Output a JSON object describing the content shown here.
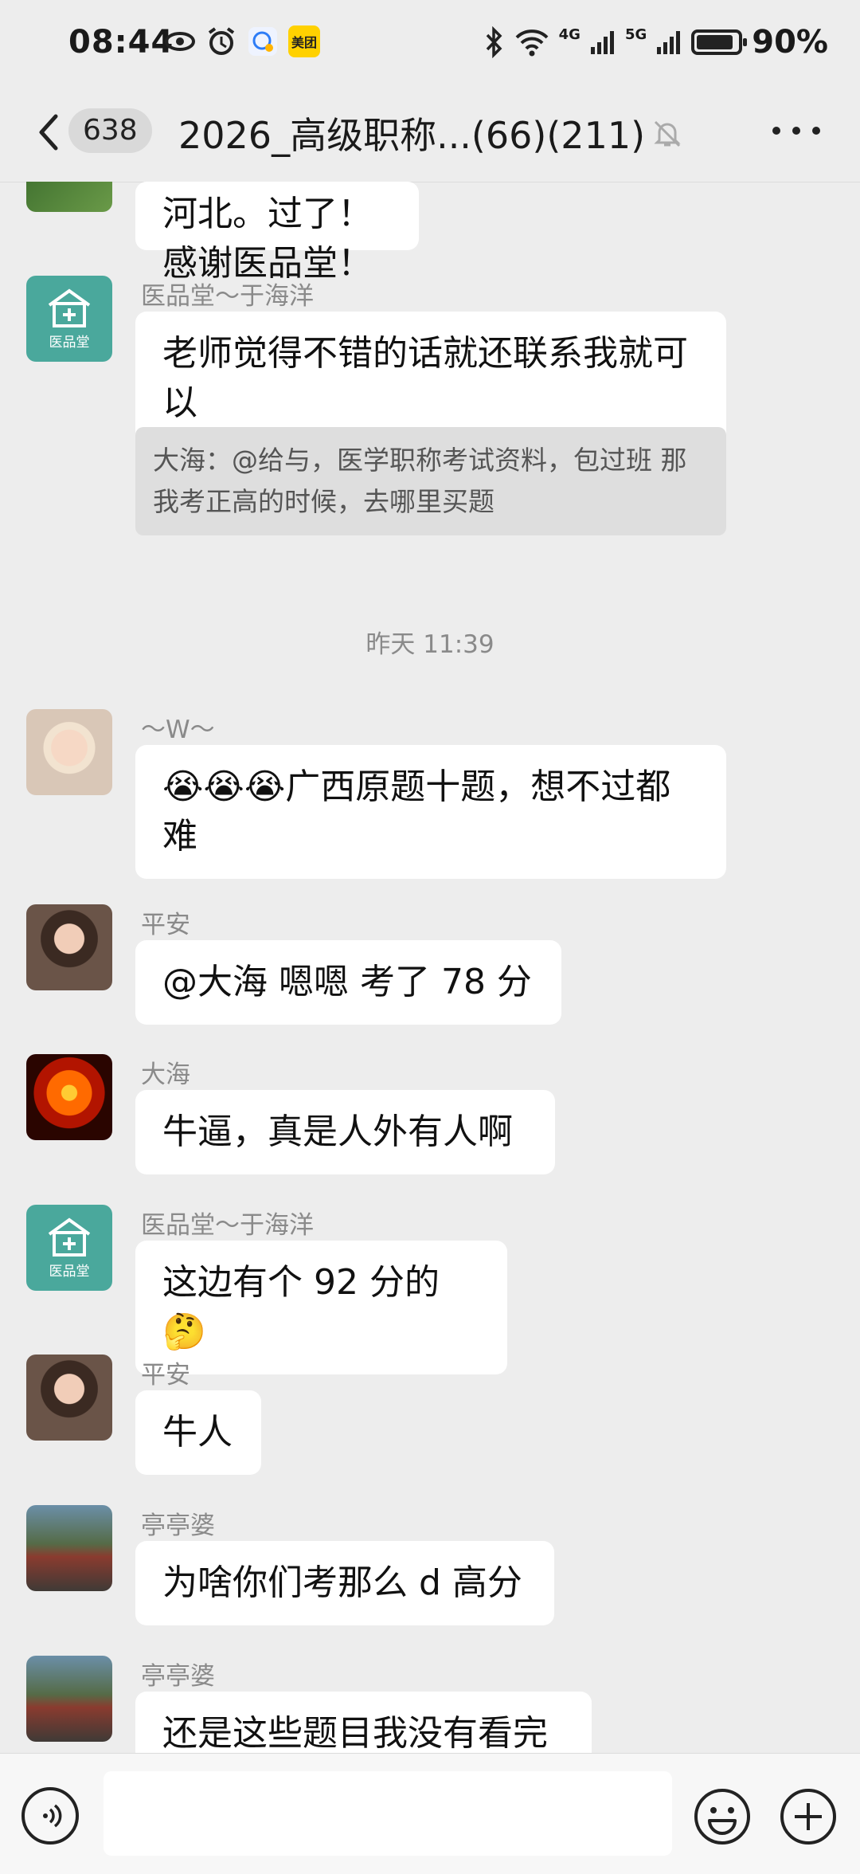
{
  "status": {
    "time": "08:44",
    "meituan": "美团",
    "net4g": "4G",
    "net5g": "5G",
    "battery_percent": "90%",
    "battery_level": 0.9
  },
  "nav": {
    "unread_count": "638",
    "title": "2026_高级职称...(66)(211)"
  },
  "chat": {
    "msg1": {
      "text": "河北。过了！感谢医品堂！"
    },
    "msg2": {
      "sender": "医品堂～于海洋",
      "text": "老师觉得不错的话就还联系我就可以",
      "quote": "大海：@给与，医学职称考试资料，包过班 那我考正高的时候，去哪里买题"
    },
    "time_separator": "昨天 11:39",
    "msg3": {
      "sender": "～W～",
      "text": "😭😭😭广西原题十题，想不过都难"
    },
    "msg4": {
      "sender": "平安",
      "text": "@大海  嗯嗯 考了 78 分"
    },
    "msg5": {
      "sender": "大海",
      "text": "牛逼，真是人外有人啊"
    },
    "msg6": {
      "sender": "医品堂～于海洋",
      "text": "这边有个 92 分的🤔"
    },
    "msg7": {
      "sender": "平安",
      "text": "牛人"
    },
    "msg8": {
      "sender": "亭亭婆",
      "text": "为啥你们考那么 d 高分"
    },
    "msg9": {
      "sender": "亭亭婆",
      "text": "还是这些题目我没有看完"
    },
    "yipintang_avatar_text": "医品堂"
  },
  "input": {
    "value": "",
    "placeholder": ""
  },
  "icons": {
    "back": "chevron-left-icon",
    "mute": "bell-off-icon",
    "more": "more-icon",
    "voice": "voice-icon",
    "emoji": "emoji-icon",
    "plus": "plus-icon"
  }
}
